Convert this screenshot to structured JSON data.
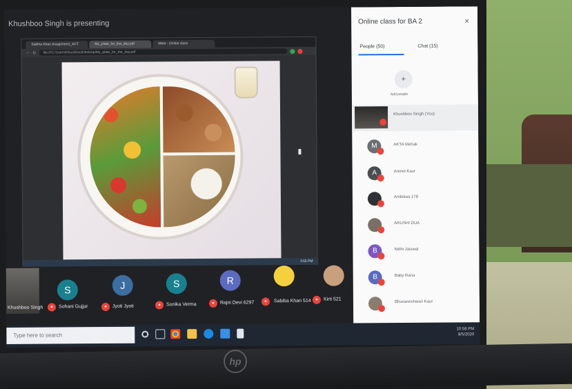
{
  "window": {
    "presenting_banner": "Khushboo Singh is presenting"
  },
  "browser": {
    "tabs": [
      "Sabiha Khan Assignment_ACT",
      "My_plate_for_the_day.pdf",
      "Meet - Online class",
      ""
    ],
    "address": "file:///C:/Users/Khushboo/Desktop/My_plate_for_the_day.pdf"
  },
  "remote_taskbar": {
    "time": "3:55 PM"
  },
  "participants": [
    {
      "name": "Sohani Gujjar",
      "initial": "S",
      "color": "#1a7f8e"
    },
    {
      "name": "Jyoti Jyoti",
      "initial": "J",
      "color": "#3c6e9f"
    },
    {
      "name": "Sonika Verma",
      "initial": "S",
      "color": "#1a7f8e"
    },
    {
      "name": "Rajni Devi 6297",
      "initial": "R",
      "color": "#5c6bc0"
    },
    {
      "name": "Sabiba Khan 514",
      "initial": "",
      "color": "#f4d03f"
    },
    {
      "name": "Kirti 521",
      "initial": "",
      "color": "#c8a07d"
    }
  ],
  "self_tile": {
    "name": "Khushboo Singh"
  },
  "panel": {
    "title": "Online class for BA 2",
    "close": "×",
    "tab_people": "People (50)",
    "tab_chat": "Chat (15)",
    "add_people": "Add people",
    "people": [
      {
        "name": "Khushboo Singh (You)",
        "initial": "",
        "color": "#555"
      },
      {
        "name": "AKTA Mehak",
        "initial": "M",
        "color": "#6b6f74"
      },
      {
        "name": "Anmol Kaur",
        "initial": "A",
        "color": "#4a4d52"
      },
      {
        "name": "Ambikaa 178",
        "initial": "",
        "color": "#2d3034"
      },
      {
        "name": "ARUSHI DUA",
        "initial": "",
        "color": "#7a6f66"
      },
      {
        "name": "Nidhi Jaiswal",
        "initial": "B",
        "color": "#7e57c2"
      },
      {
        "name": "Baby Rana",
        "initial": "B",
        "color": "#5c6bc0"
      },
      {
        "name": "Bhuvaneshwari Kaur",
        "initial": "",
        "color": "#8a7d70"
      }
    ]
  },
  "windows_taskbar": {
    "search_placeholder": "Type here to search",
    "clock_time": "10:58 PM",
    "clock_date": "8/5/2020"
  },
  "laptop": {
    "logo": "hp"
  }
}
